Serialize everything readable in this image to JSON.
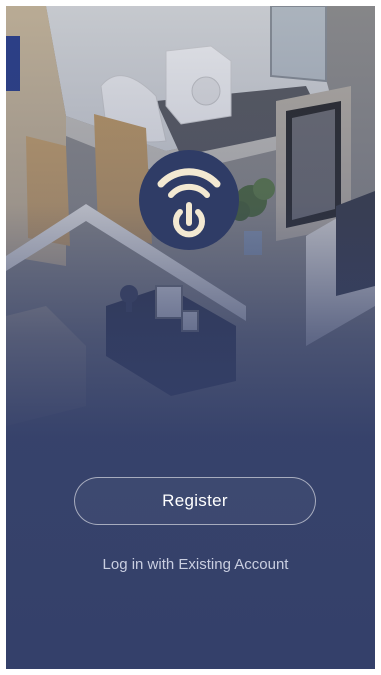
{
  "app": {
    "logo_icon": "power-wifi-icon",
    "background": "isometric-floor-plan-illustration"
  },
  "actions": {
    "register_label": "Register",
    "login_label": "Log in with Existing Account"
  },
  "colors": {
    "overlay": "#34406a",
    "logo_bg": "#2f3c66",
    "logo_symbol": "#f3e9d2",
    "button_text": "#ffffff",
    "link_text": "#c9cee0"
  }
}
